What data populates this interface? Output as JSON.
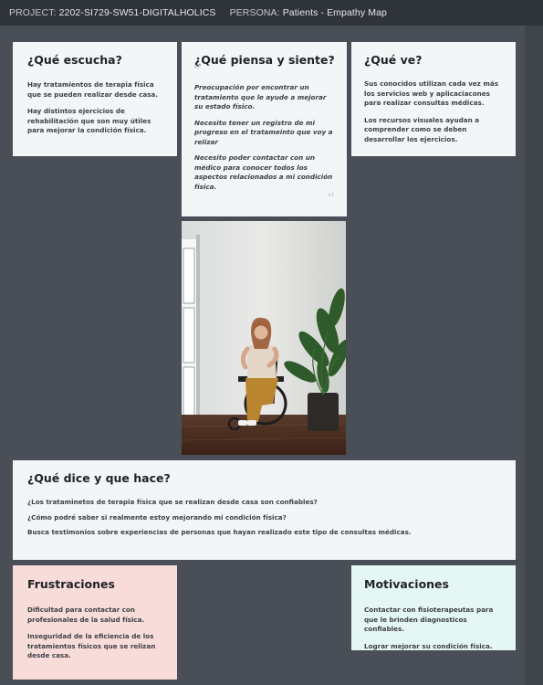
{
  "header": {
    "project_label": "PROJECT:",
    "project_value": "2202-SI729-SW51-DIGITALHOLICS",
    "persona_label": "PERSONA:",
    "persona_value": "Patients - Empathy Map"
  },
  "escucha": {
    "title": "¿Qué escucha?",
    "items": [
      "Hay tratamientos de terapia física  que se pueden realizar desde casa.",
      "Hay distintos  ejercicios  de rehabilitación que son muy útiles  para mejorar la condición física."
    ]
  },
  "piensa": {
    "title": "¿Qué piensa y siente?",
    "items": [
      "Preocupación por encontrar un tratamiento que le ayude a mejorar su estado físico.",
      "Necesito tener un registro de mi progreso en el tratameinto que voy a relizar",
      "Necesito poder contactar con un médico para conocer  todos los aspectos relacionados a mi condición física."
    ]
  },
  "ve": {
    "title": "¿Qué ve?",
    "items": [
      "Sus conocidos utilizan cada vez más los servicios web y aplicaciacones para realizar consultas médicas.",
      "Los recursos visuales ayudan  a comprender como se deben desarrollar los ejercicios."
    ]
  },
  "dice": {
    "title": "¿Qué dice y que hace?",
    "items": [
      "¿Los trataminetos de terapia física que se realizan desde casa son confiables?",
      "¿Cómo podré saber si realmente estoy mejorando mi condición física?",
      "Busca testimonios sobre experiencias de personas que hayan realizado este tipo de consultas médicas."
    ]
  },
  "frustraciones": {
    "title": "Frustraciones",
    "items": [
      "Dificultad para contactar con profesionales de la salud física.",
      "Inseguridad de la eficiencia de los tratamientos físicos que se relizan desde casa."
    ]
  },
  "motivaciones": {
    "title": "Motivaciones",
    "items": [
      "Contactar con fisioterapeutas para que le brinden diagnosticos confiables.",
      "Lograr mejorar su condición física."
    ]
  },
  "colors": {
    "background": "#4a4f57",
    "card": "#f4f5f6",
    "frustraciones": "#f8dcd9",
    "motivaciones": "#e5f7f3"
  }
}
